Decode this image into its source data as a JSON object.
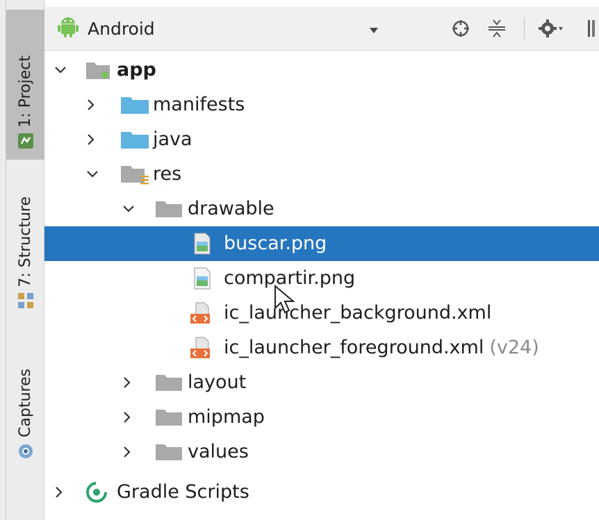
{
  "side_tabs": [
    {
      "label": "1: Project",
      "active": true
    },
    {
      "label": "7: Structure",
      "active": false
    },
    {
      "label": "Captures",
      "active": false
    }
  ],
  "header": {
    "view_name": "Android",
    "icons": [
      "android-icon",
      "locate-icon",
      "collapse-icon",
      "gear-icon",
      "hide-icon"
    ]
  },
  "tree": {
    "app": "app",
    "manifests": "manifests",
    "java": "java",
    "res": "res",
    "drawable": "drawable",
    "buscar": "buscar.png",
    "compartir": "compartir.png",
    "ic_bg": "ic_launcher_background.xml",
    "ic_fg": "ic_launcher_foreground.xml",
    "ic_fg_suffix": "(v24)",
    "layout": "layout",
    "mipmap": "mipmap",
    "values": "values",
    "gradle": "Gradle Scripts",
    "selected": "buscar.png"
  },
  "colors": {
    "selection": "#2675bf",
    "folder_blue": "#5fb3e0",
    "folder_gray": "#a9a9a9",
    "android_green": "#78c257",
    "xml_orange": "#e8703a"
  }
}
